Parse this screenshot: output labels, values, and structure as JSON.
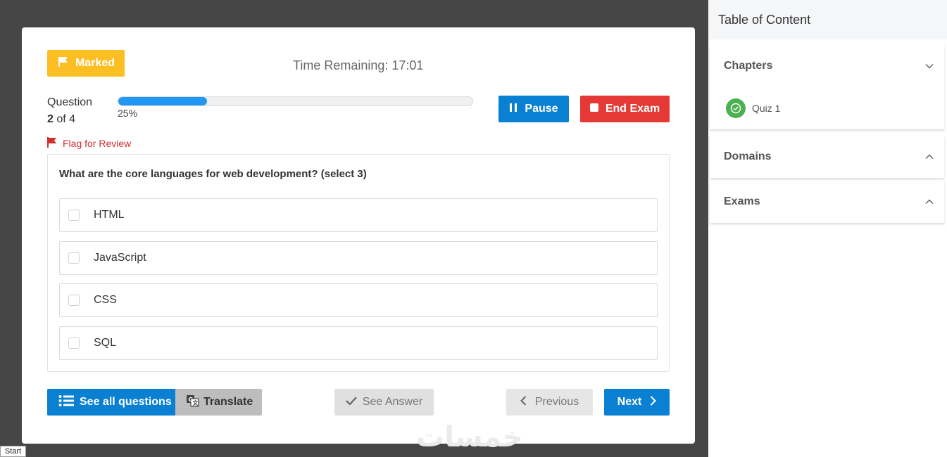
{
  "header": {
    "marked_label": "Marked",
    "timer_text": "Time Remaining: 17:01"
  },
  "progress": {
    "question_word": "Question",
    "current": "2",
    "of_total": " of 4",
    "percent_text": "25%",
    "fraction": 0.25
  },
  "controls": {
    "pause_label": "Pause",
    "end_label": "End Exam"
  },
  "flag": {
    "label": "Flag for Review"
  },
  "question": {
    "text": "What are the core languages for web development? (select 3)",
    "options": [
      {
        "label": "HTML"
      },
      {
        "label": "JavaScript"
      },
      {
        "label": "CSS"
      },
      {
        "label": "SQL"
      }
    ]
  },
  "footer": {
    "see_all_label": "See all questions",
    "translate_label": "Translate",
    "see_answer_label": "See Answer",
    "previous_label": "Previous",
    "next_label": "Next"
  },
  "watermark": "خمسات",
  "start_label": "Start",
  "sidebar": {
    "title": "Table of Content",
    "sections": [
      {
        "label": "Chapters",
        "expanded": true,
        "items": [
          {
            "label": "Quiz 1"
          }
        ]
      },
      {
        "label": "Domains",
        "expanded": false
      },
      {
        "label": "Exams",
        "expanded": false
      }
    ]
  },
  "colors": {
    "marked": "#fbbf24",
    "primary": "#0a80d2",
    "danger": "#e53935",
    "progress": "#2196f3",
    "success": "#4caf50"
  }
}
